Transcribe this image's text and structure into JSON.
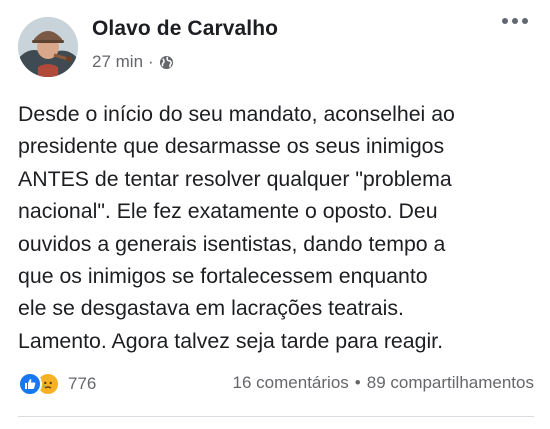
{
  "post": {
    "author": "Olavo de Carvalho",
    "time": "27 min",
    "separator": "·",
    "privacy_icon": "globe-icon",
    "options_icon": "more-options-icon",
    "text_lines": [
      "Desde o início do seu mandato, aconselhei ao",
      "presidente que desarmasse os seus inimigos",
      "ANTES de tentar resolver qualquer \"problema",
      "nacional\". Ele fez exatamente o oposto. Deu",
      "ouvidos a generais isentistas, dando tempo a",
      "que os inimigos se fortalecessem enquanto",
      "ele se desgastava em lacrações teatrais.",
      "Lamento. Agora talvez seja tarde para reagir."
    ]
  },
  "reactions": {
    "icons": [
      "like-reaction-icon",
      "sad-reaction-icon"
    ],
    "count": "776"
  },
  "stats": {
    "comments": "16 comentários",
    "separator": "•",
    "shares": "89 compartilhamentos"
  },
  "colors": {
    "text": "#1c1e21",
    "secondary": "#65676b",
    "like_blue": "#1877f2",
    "sad_yellow": "#f7b125"
  }
}
